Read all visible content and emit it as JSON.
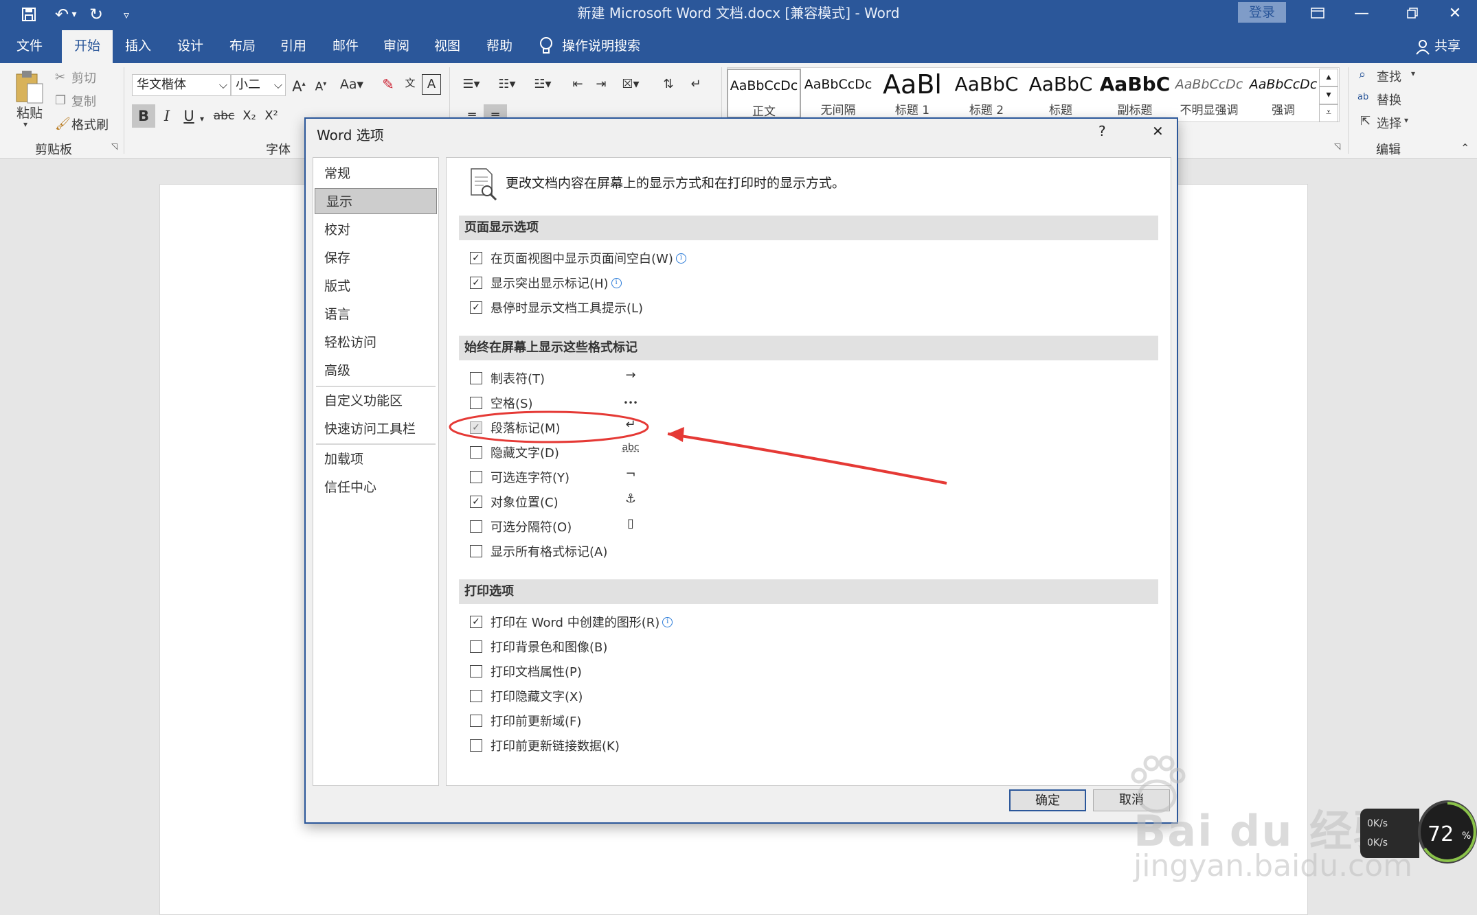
{
  "window": {
    "title": "新建 Microsoft Word 文档.docx [兼容模式] - Word",
    "login_label": "登录",
    "accent_color": "#2b579a"
  },
  "ribbon_tabs": [
    "文件",
    "开始",
    "插入",
    "设计",
    "布局",
    "引用",
    "邮件",
    "审阅",
    "视图",
    "帮助"
  ],
  "active_tab": "开始",
  "tell_me": "操作说明搜索",
  "share_label": "共享",
  "clipboard": {
    "paste": "粘贴",
    "cut": "剪切",
    "copy": "复制",
    "format_painter": "格式刷",
    "group": "剪贴板"
  },
  "font": {
    "name": "华文楷体",
    "size": "小二",
    "group": "字体",
    "bold": "B",
    "italic": "I",
    "underline": "U",
    "strike": "abc",
    "sub": "X₂",
    "sup": "X²"
  },
  "styles": [
    {
      "sample": "AaBbCcDc",
      "name": "正文"
    },
    {
      "sample": "AaBbCcDc",
      "name": "无间隔"
    },
    {
      "sample": "AaBl",
      "name": "标题 1"
    },
    {
      "sample": "AaBbC",
      "name": "标题 2"
    },
    {
      "sample": "AaBbC",
      "name": "标题"
    },
    {
      "sample": "AaBbC",
      "name": "副标题"
    },
    {
      "sample": "AaBbCcDc",
      "name": "不明显强调"
    },
    {
      "sample": "AaBbCcDc",
      "name": "强调"
    }
  ],
  "editing": {
    "find": "查找",
    "replace": "替换",
    "select": "选择",
    "group": "编辑"
  },
  "dialog": {
    "title": "Word 选项",
    "help": "?",
    "close": "✕",
    "nav": [
      "常规",
      "显示",
      "校对",
      "保存",
      "版式",
      "语言",
      "轻松访问",
      "高级",
      "自定义功能区",
      "快速访问工具栏",
      "加载项",
      "信任中心"
    ],
    "selected_nav": "显示",
    "intro": "更改文档内容在屏幕上的显示方式和在打印时的显示方式。",
    "sections": {
      "page_display": {
        "header": "页面显示选项",
        "options": [
          {
            "label": "在页面视图中显示页面间空白(W)",
            "checked": true,
            "info": true
          },
          {
            "label": "显示突出显示标记(H)",
            "checked": true,
            "info": true
          },
          {
            "label": "悬停时显示文档工具提示(L)",
            "checked": true,
            "info": false
          }
        ]
      },
      "format_marks": {
        "header": "始终在屏幕上显示这些格式标记",
        "options": [
          {
            "label": "制表符(T)",
            "checked": false,
            "symbol": "→"
          },
          {
            "label": "空格(S)",
            "checked": false,
            "symbol": "•••"
          },
          {
            "label": "段落标记(M)",
            "checked": true,
            "symbol": "↵"
          },
          {
            "label": "隐藏文字(D)",
            "checked": false,
            "symbol": "abc"
          },
          {
            "label": "可选连字符(Y)",
            "checked": false,
            "symbol": "¬"
          },
          {
            "label": "对象位置(C)",
            "checked": true,
            "symbol": "⚓"
          },
          {
            "label": "可选分隔符(O)",
            "checked": false,
            "symbol": "▯"
          },
          {
            "label": "显示所有格式标记(A)",
            "checked": false,
            "symbol": ""
          }
        ]
      },
      "print": {
        "header": "打印选项",
        "options": [
          {
            "label": "打印在 Word 中创建的图形(R)",
            "checked": true,
            "info": true
          },
          {
            "label": "打印背景色和图像(B)",
            "checked": false,
            "info": false
          },
          {
            "label": "打印文档属性(P)",
            "checked": false,
            "info": false
          },
          {
            "label": "打印隐藏文字(X)",
            "checked": false,
            "info": false
          },
          {
            "label": "打印前更新域(F)",
            "checked": false,
            "info": false
          },
          {
            "label": "打印前更新链接数据(K)",
            "checked": false,
            "info": false
          }
        ]
      }
    },
    "ok": "确定",
    "cancel": "取消"
  },
  "overlay": {
    "watermark_brand": "Bai du 经验",
    "watermark_url": "jingyan.baidu.com",
    "net_up": "0K/s",
    "net_down": "0K/s",
    "cpu_percent": "72",
    "cpu_unit": "%"
  }
}
